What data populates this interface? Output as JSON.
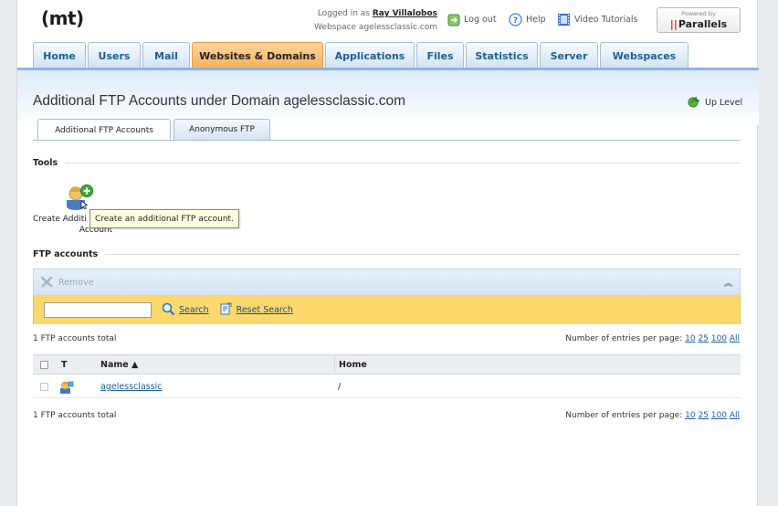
{
  "header": {
    "logo": "(mt)",
    "logged_in_prefix": "Logged in as",
    "user": "Ray Villalobos",
    "webspace_label": "Webspace agelessclassic.com",
    "logout": "Log out",
    "help": "Help",
    "video_tutorials": "Video Tutorials",
    "powered_by": "Powered by",
    "parallels": "Parallels"
  },
  "nav": {
    "tabs": [
      {
        "label": "Home",
        "active": false
      },
      {
        "label": "Users",
        "active": false
      },
      {
        "label": "Mail",
        "active": false
      },
      {
        "label": "Websites & Domains",
        "active": true
      },
      {
        "label": "Applications",
        "active": false
      },
      {
        "label": "Files",
        "active": false
      },
      {
        "label": "Statistics",
        "active": false
      },
      {
        "label": "Server",
        "active": false
      },
      {
        "label": "Webspaces",
        "active": false
      }
    ]
  },
  "page": {
    "title": "Additional FTP Accounts under Domain agelessclassic.com",
    "up_level": "Up Level",
    "subtabs": [
      "Additional FTP Accounts",
      "Anonymous FTP"
    ]
  },
  "tools": {
    "heading": "Tools",
    "create_label_line1": "Create Additi",
    "create_label_line2": "Account",
    "tooltip": "Create an additional FTP account."
  },
  "ftp": {
    "heading": "FTP accounts",
    "remove": "Remove",
    "search_placeholder": "",
    "search": "Search",
    "reset_search": "Reset Search",
    "total": "1 FTP accounts total",
    "entries_label": "Number of entries per page:",
    "entries_options": [
      "10",
      "25",
      "100",
      "All"
    ],
    "columns": {
      "type": "T",
      "name": "Name ▲",
      "home": "Home"
    },
    "rows": [
      {
        "name": "agelessclassic",
        "home": "/"
      }
    ]
  },
  "colors": {
    "active_tab": "#f6b05a",
    "nav_accent": "#8eb5de",
    "search_bar": "#fbd96d",
    "link": "#1d5fa8"
  }
}
